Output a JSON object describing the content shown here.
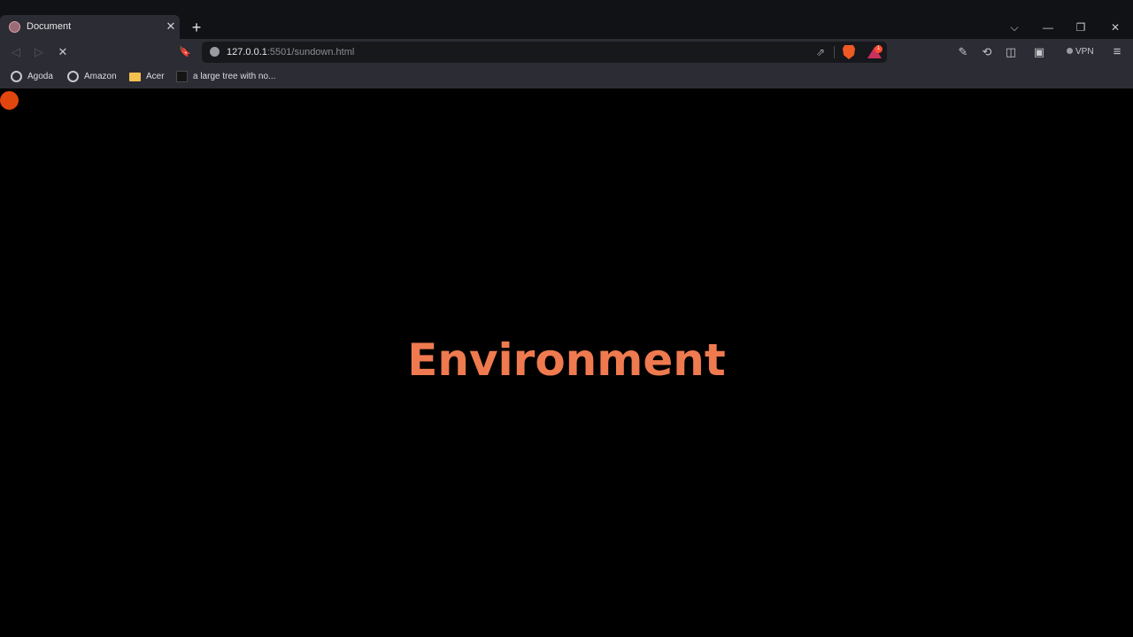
{
  "tab": {
    "title": "Document",
    "close_glyph": "✕"
  },
  "new_tab_glyph": "+",
  "window_controls": {
    "tabs_dropdown": "⌵",
    "minimize": "—",
    "restore": "❐",
    "close": "✕"
  },
  "toolbar": {
    "back_glyph": "◁",
    "forward_glyph": "▷",
    "stop_glyph": "✕",
    "bookmark_glyph": "🔖",
    "url_host": "127.0.0.1",
    "url_rest": ":5501/sundown.html",
    "share_glyph": "⇗",
    "rewards_badge": "1",
    "edit_glyph": "✎",
    "sync_glyph": "⟲",
    "sidebar_glyph": "◫",
    "wallet_glyph": "▣",
    "vpn_label": "VPN",
    "menu_glyph": "≡"
  },
  "bookmarks": [
    {
      "label": "Agoda",
      "icon": "globe-icon"
    },
    {
      "label": "Amazon",
      "icon": "globe-icon"
    },
    {
      "label": "Acer",
      "icon": "folder-icon"
    },
    {
      "label": "a large tree with no...",
      "icon": "image-thumbnail-icon"
    }
  ],
  "page": {
    "headline": "Environment",
    "headline_color": "#ef7a4f",
    "cursor_color": "#e2460f"
  }
}
